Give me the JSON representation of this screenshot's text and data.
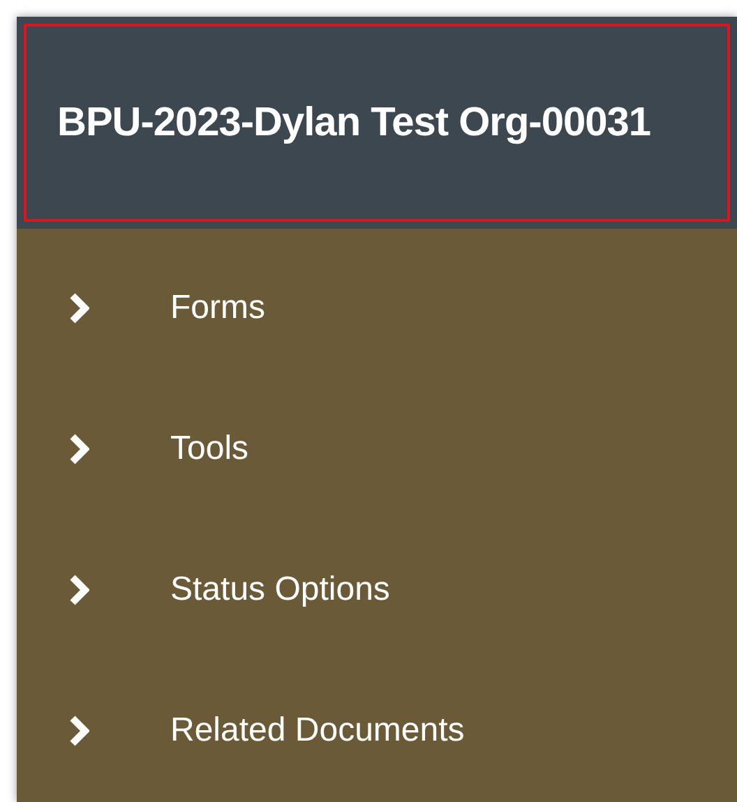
{
  "header": {
    "title": "BPU-2023-Dylan Test Org-00031",
    "highlighted": true
  },
  "menu": [
    {
      "label": "Forms",
      "expanded": false
    },
    {
      "label": "Tools",
      "expanded": false
    },
    {
      "label": "Status Options",
      "expanded": false
    },
    {
      "label": "Related Documents",
      "expanded": false
    }
  ]
}
